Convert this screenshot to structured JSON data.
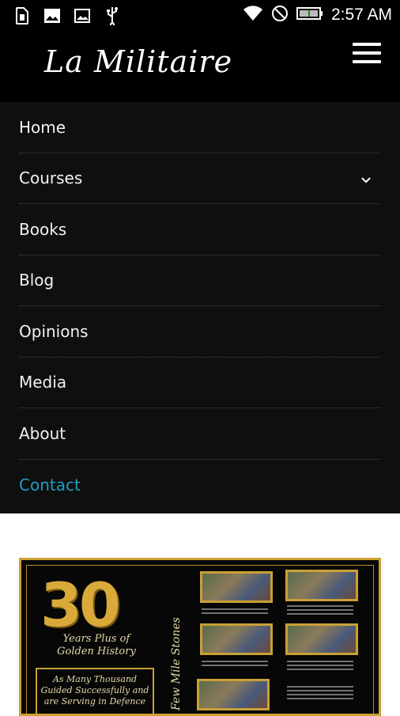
{
  "status_bar": {
    "time": "2:57 AM",
    "left_icons": [
      "sim-card-icon",
      "image-icon",
      "photo-icon",
      "usb-icon"
    ],
    "right_icons": [
      "wifi-icon",
      "do-not-disturb-icon",
      "battery-icon"
    ]
  },
  "header": {
    "logo_text": "La Militaire",
    "menu_icon": "hamburger-menu-icon"
  },
  "menu": {
    "items": [
      {
        "label": "Home"
      },
      {
        "label": "Courses",
        "has_submenu": true
      },
      {
        "label": "Books"
      },
      {
        "label": "Blog"
      },
      {
        "label": "Opinions"
      },
      {
        "label": "Media"
      },
      {
        "label": "About"
      },
      {
        "label": "Contact",
        "active": true
      }
    ],
    "active_color": "#1e9fc2"
  },
  "poster": {
    "number": "30",
    "years_text": "Years Plus of Golden History",
    "box_text": "As Many Thousand Guided Successfully and are Serving in Defence",
    "vertical_text": "Few Mile Stones"
  },
  "colors": {
    "background": "#000000",
    "menu_background": "#0f0f0f",
    "gold": "#caa032"
  }
}
